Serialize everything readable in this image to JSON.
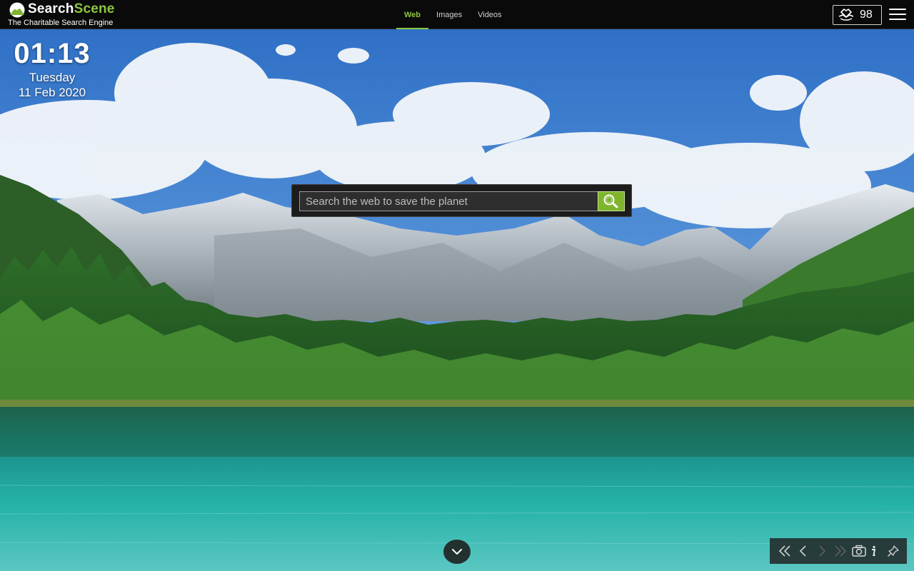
{
  "brand": {
    "name_part1": "Search",
    "name_part2": "Scene",
    "tagline": "The Charitable Search Engine",
    "accent_color": "#8ec63f"
  },
  "nav": {
    "tabs": [
      {
        "label": "Web",
        "active": true
      },
      {
        "label": "Images",
        "active": false
      },
      {
        "label": "Videos",
        "active": false
      }
    ]
  },
  "counter": {
    "icon": "hand-heart-icon",
    "value": "98"
  },
  "menu": {
    "icon": "hamburger-menu-icon"
  },
  "clock": {
    "time": "01:13",
    "day": "Tuesday",
    "date": "11 Feb 2020"
  },
  "search": {
    "placeholder": "Search the web to save the planet",
    "value": "",
    "button_icon": "search-icon",
    "button_color": "#7fb42d"
  },
  "bottom": {
    "scroll_icon": "chevron-down-icon",
    "controls": [
      {
        "icon": "double-chevron-left-icon"
      },
      {
        "icon": "chevron-left-icon"
      },
      {
        "icon": "chevron-right-icon"
      },
      {
        "icon": "double-chevron-right-icon"
      },
      {
        "icon": "camera-icon"
      },
      {
        "icon": "info-icon"
      },
      {
        "icon": "pin-icon"
      }
    ]
  }
}
